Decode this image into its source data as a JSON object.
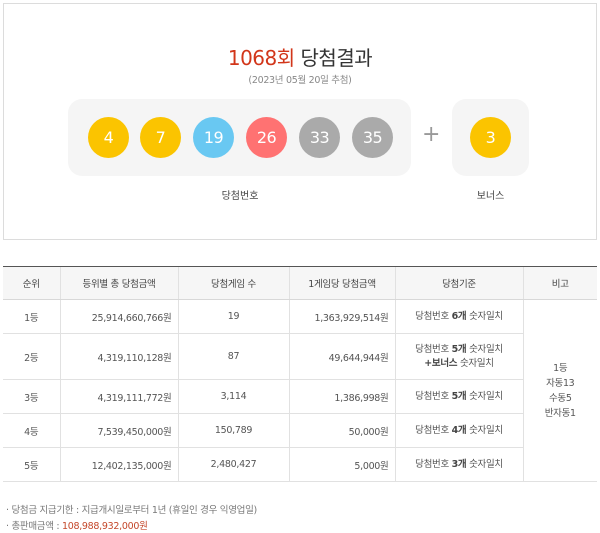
{
  "header": {
    "round": "1068회",
    "title_suffix": "당첨결과",
    "draw_date": "(2023년 05월 20일 추첨)"
  },
  "numbers": {
    "main": [
      {
        "value": "4",
        "color": "#fbc400"
      },
      {
        "value": "7",
        "color": "#fbc400"
      },
      {
        "value": "19",
        "color": "#69c8f2"
      },
      {
        "value": "26",
        "color": "#ff7272"
      },
      {
        "value": "33",
        "color": "#aaaaaa"
      },
      {
        "value": "35",
        "color": "#aaaaaa"
      }
    ],
    "plus": "+",
    "bonus": {
      "value": "3",
      "color": "#fbc400"
    },
    "main_label": "당첨번호",
    "bonus_label": "보너스"
  },
  "table": {
    "headers": [
      "순위",
      "등위별 총 당첨금액",
      "당첨게임 수",
      "1게임당 당첨금액",
      "당첨기준",
      "비고"
    ],
    "rows": [
      {
        "rank": "1등",
        "total": "25,914,660,766원",
        "games": "19",
        "per_game": "1,363,929,514원",
        "crit_pre": "당첨번호 ",
        "crit_bold": "6개",
        "crit_post": " 숫자일치",
        "crit_line2_bold": "",
        "crit_line2": ""
      },
      {
        "rank": "2등",
        "total": "4,319,110,128원",
        "games": "87",
        "per_game": "49,644,944원",
        "crit_pre": "당첨번호 ",
        "crit_bold": "5개",
        "crit_post": " 숫자일치",
        "crit_line2_bold": "+보너스",
        "crit_line2": " 숫자일치"
      },
      {
        "rank": "3등",
        "total": "4,319,111,772원",
        "games": "3,114",
        "per_game": "1,386,998원",
        "crit_pre": "당첨번호 ",
        "crit_bold": "5개",
        "crit_post": " 숫자일치",
        "crit_line2_bold": "",
        "crit_line2": ""
      },
      {
        "rank": "4등",
        "total": "7,539,450,000원",
        "games": "150,789",
        "per_game": "50,000원",
        "crit_pre": "당첨번호 ",
        "crit_bold": "4개",
        "crit_post": " 숫자일치",
        "crit_line2_bold": "",
        "crit_line2": ""
      },
      {
        "rank": "5등",
        "total": "12,402,135,000원",
        "games": "2,480,427",
        "per_game": "5,000원",
        "crit_pre": "당첨번호 ",
        "crit_bold": "3개",
        "crit_post": " 숫자일치",
        "crit_line2_bold": "",
        "crit_line2": ""
      }
    ],
    "note": [
      "1등",
      "자동13",
      "수동5",
      "반자동1"
    ]
  },
  "footer": {
    "deadline": "· 당첨금 지급기한 : 지급개시일로부터 1년 (휴일인 경우 익영업일)",
    "sales_label": "· 총판매금액 : ",
    "sales_value": "108,988,932,000원"
  }
}
